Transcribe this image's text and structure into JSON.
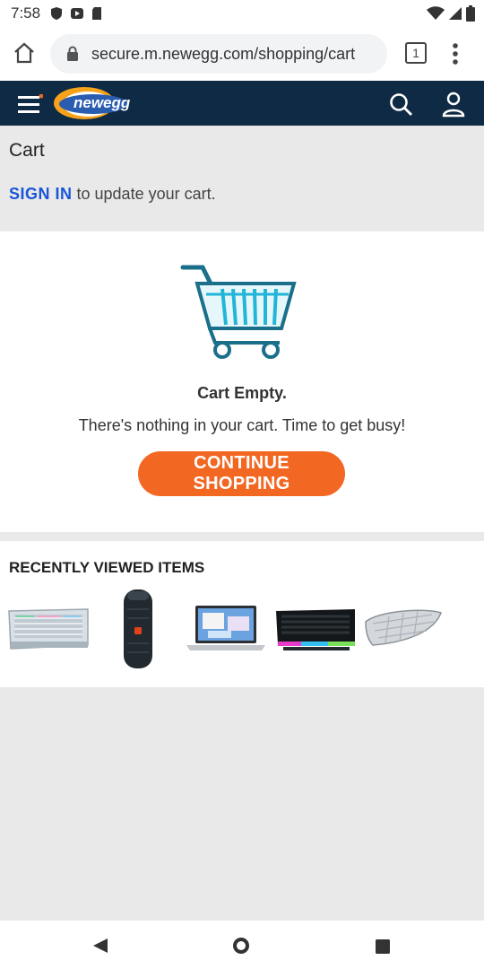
{
  "status_bar": {
    "time": "7:58",
    "left_icons": [
      "shield-icon",
      "play-icon",
      "sd-card-icon"
    ],
    "right_icons": [
      "wifi-icon",
      "signal-icon",
      "battery-icon"
    ]
  },
  "browser": {
    "url": "secure.m.newegg.com/shopping/cart",
    "tab_count": "1",
    "icons": [
      "home-icon",
      "lock-icon",
      "tab-switcher-icon",
      "menu-icon"
    ]
  },
  "header": {
    "logo_text": "newegg",
    "icons": [
      "hamburger-icon",
      "search-icon",
      "account-icon"
    ],
    "bg_color": "#0f2a44"
  },
  "cart": {
    "title": "Cart",
    "sign_in_label": "SIGN IN",
    "sign_in_suffix": " to update your cart.",
    "empty_title": "Cart Empty.",
    "empty_message": "There's nothing in your cart. Time to get busy!",
    "continue_label": "CONTINUE SHOPPING",
    "accent_color": "#f26722"
  },
  "recently_viewed": {
    "title": "RECENTLY VIEWED ITEMS",
    "items": [
      "keyboard-white",
      "speaker",
      "laptop",
      "keyboard-rgb",
      "sunshade"
    ]
  },
  "nav": {
    "icons": [
      "back-icon",
      "home-circle-icon",
      "recents-icon"
    ]
  }
}
